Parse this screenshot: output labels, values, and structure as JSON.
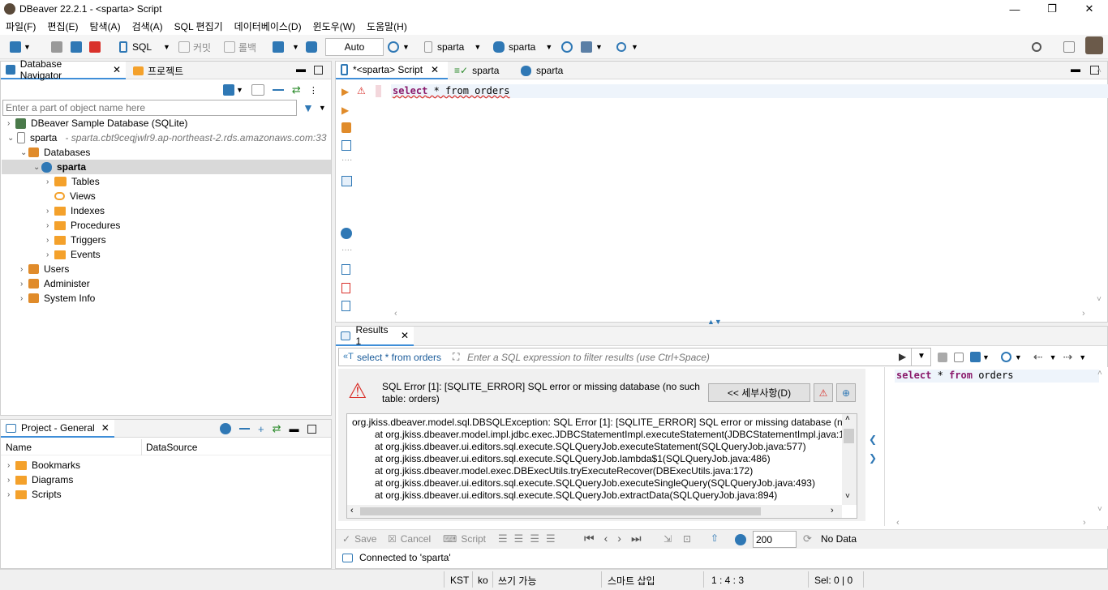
{
  "window": {
    "title": "DBeaver 22.2.1 - <sparta> Script",
    "minimize": "—",
    "restore": "❐",
    "close": "✕"
  },
  "menu": [
    "파일(F)",
    "편집(E)",
    "탐색(A)",
    "검색(A)",
    "SQL 편집기",
    "데이터베이스(D)",
    "윈도우(W)",
    "도움말(H)"
  ],
  "toolbar": {
    "sql_label": "SQL",
    "commit_label": "커밋",
    "rollback_label": "롤백",
    "tx_mode": "Auto",
    "datasource": "sparta",
    "schema": "sparta"
  },
  "navigator": {
    "tab_label": "Database Navigator",
    "tab2_label": "프로젝트",
    "filter_placeholder": "Enter a part of object name here",
    "items": [
      {
        "label": "DBeaver Sample Database (SQLite)"
      },
      {
        "label": "sparta",
        "desc": "- sparta.cbt9ceqjwlr9.ap-northeast-2.rds.amazonaws.com:33"
      },
      {
        "label": "Databases"
      },
      {
        "label": "sparta"
      },
      {
        "label": "Tables"
      },
      {
        "label": "Views"
      },
      {
        "label": "Indexes"
      },
      {
        "label": "Procedures"
      },
      {
        "label": "Triggers"
      },
      {
        "label": "Events"
      },
      {
        "label": "Users"
      },
      {
        "label": "Administer"
      },
      {
        "label": "System Info"
      }
    ]
  },
  "project": {
    "tab_label": "Project - General",
    "col_name": "Name",
    "col_datasource": "DataSource",
    "items": [
      {
        "label": "Bookmarks"
      },
      {
        "label": "Diagrams"
      },
      {
        "label": "Scripts"
      }
    ]
  },
  "editor": {
    "tabs": [
      {
        "label": "*<sparta> Script"
      },
      {
        "label": "sparta"
      },
      {
        "label": "sparta"
      }
    ],
    "query_keyword1": "select",
    "query_rest": " * from orders"
  },
  "results": {
    "tab_label": "Results 1",
    "query_chip": "select * from orders",
    "filter_placeholder": "Enter a SQL expression to filter results (use Ctrl+Space)",
    "error_message": "SQL Error [1]: [SQLITE_ERROR] SQL error or missing database (no such table: orders)",
    "details_button": "<< 세부사항(D)",
    "stack": [
      "org.jkiss.dbeaver.model.sql.DBSQLException: SQL Error [1]: [SQLITE_ERROR] SQL error or missing database (no s",
      "at org.jkiss.dbeaver.model.impl.jdbc.exec.JDBCStatementImpl.executeStatement(JDBCStatementImpl.java:1",
      "at org.jkiss.dbeaver.ui.editors.sql.execute.SQLQueryJob.executeStatement(SQLQueryJob.java:577)",
      "at org.jkiss.dbeaver.ui.editors.sql.execute.SQLQueryJob.lambda$1(SQLQueryJob.java:486)",
      "at org.jkiss.dbeaver.model.exec.DBExecUtils.tryExecuteRecover(DBExecUtils.java:172)",
      "at org.jkiss.dbeaver.ui.editors.sql.execute.SQLQueryJob.executeSingleQuery(SQLQueryJob.java:493)",
      "at org.jkiss.dbeaver.ui.editors.sql.execute.SQLQueryJob.extractData(SQLQueryJob.java:894)"
    ],
    "side_query_kw": "select",
    "side_query_from": "from",
    "side_query_table": "orders",
    "save": "Save",
    "cancel": "Cancel",
    "script": "Script",
    "fetch_size": "200",
    "no_data": "No Data",
    "connected": "Connected to 'sparta'"
  },
  "status": {
    "tz": "KST",
    "locale": "ko",
    "mode": "쓰기 가능",
    "insert": "스마트 삽입",
    "pos": "1 : 4 : 3",
    "sel": "Sel: 0 | 0"
  },
  "colors": {
    "accent": "#3f8ed8",
    "error": "#d9312b",
    "folder": "#f4a12b",
    "keyword": "#8a1a6b"
  }
}
